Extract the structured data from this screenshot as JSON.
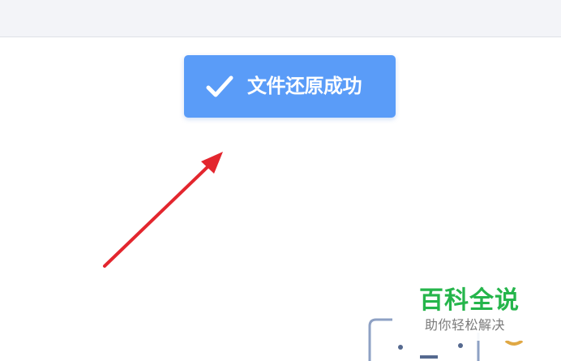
{
  "toast": {
    "message": "文件还原成功",
    "icon": "check-icon",
    "background": "#5a9cf8"
  },
  "annotation": {
    "arrow_color": "#e3262e"
  },
  "watermark": {
    "title": "百科全说",
    "subtitle": "助你轻松解决",
    "title_color": "#25b54b",
    "subtitle_color": "#7b7b7b"
  }
}
